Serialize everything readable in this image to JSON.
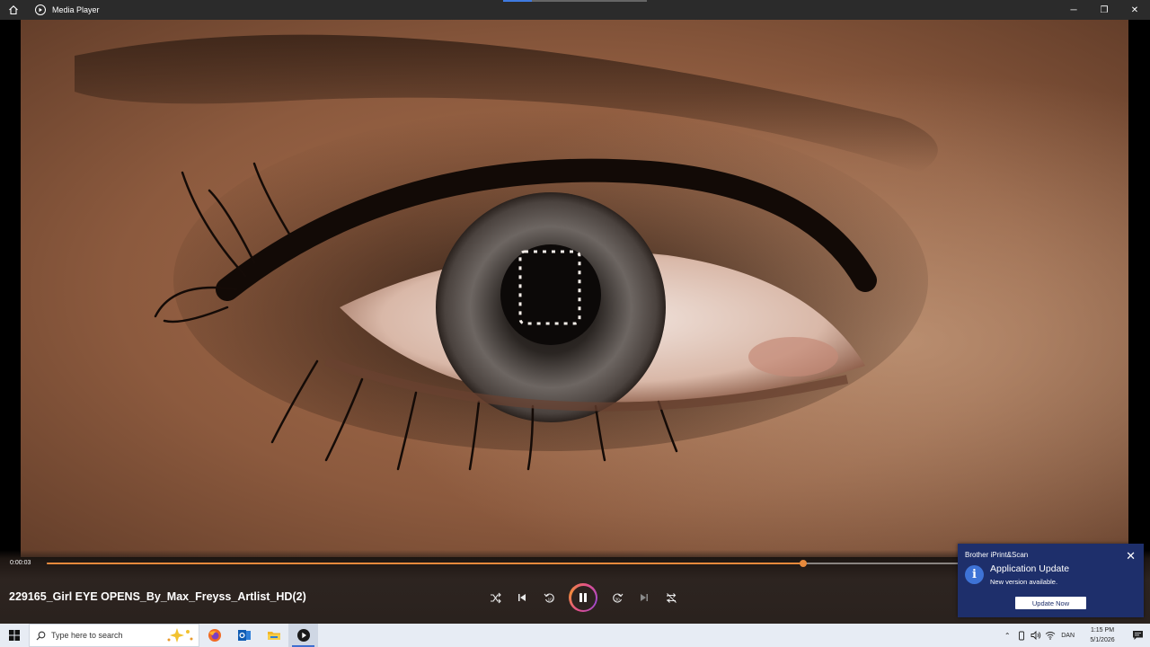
{
  "window": {
    "title": "Media Player",
    "controls": {
      "minimize": "─",
      "restore": "❐",
      "close": "✕"
    }
  },
  "player": {
    "current_time": "0:00:03",
    "progress": 0.825,
    "now_playing": "229165_Girl EYE OPENS_By_Max_Freyss_Artlist_HD(2)",
    "accent_color": "#e88a3c",
    "controls": [
      "shuffle-icon",
      "previous-icon",
      "rewind-10-icon",
      "pause-icon",
      "forward-30-icon",
      "next-icon",
      "repeat-off-icon"
    ]
  },
  "toast": {
    "app_name": "Brother iPrint&Scan",
    "title": "Application Update",
    "message": "New version available.",
    "action_label": "Update Now",
    "close_glyph": "✕",
    "info_glyph": "i",
    "background_color": "#1e2f6b"
  },
  "taskbar": {
    "search_placeholder": "Type here to search",
    "apps": [
      "firefox-icon",
      "outlook-icon",
      "file-explorer-icon",
      "media-player-icon"
    ],
    "tray": {
      "language": "DAN",
      "time": "1:15 PM",
      "date": "5/1/2026"
    }
  }
}
